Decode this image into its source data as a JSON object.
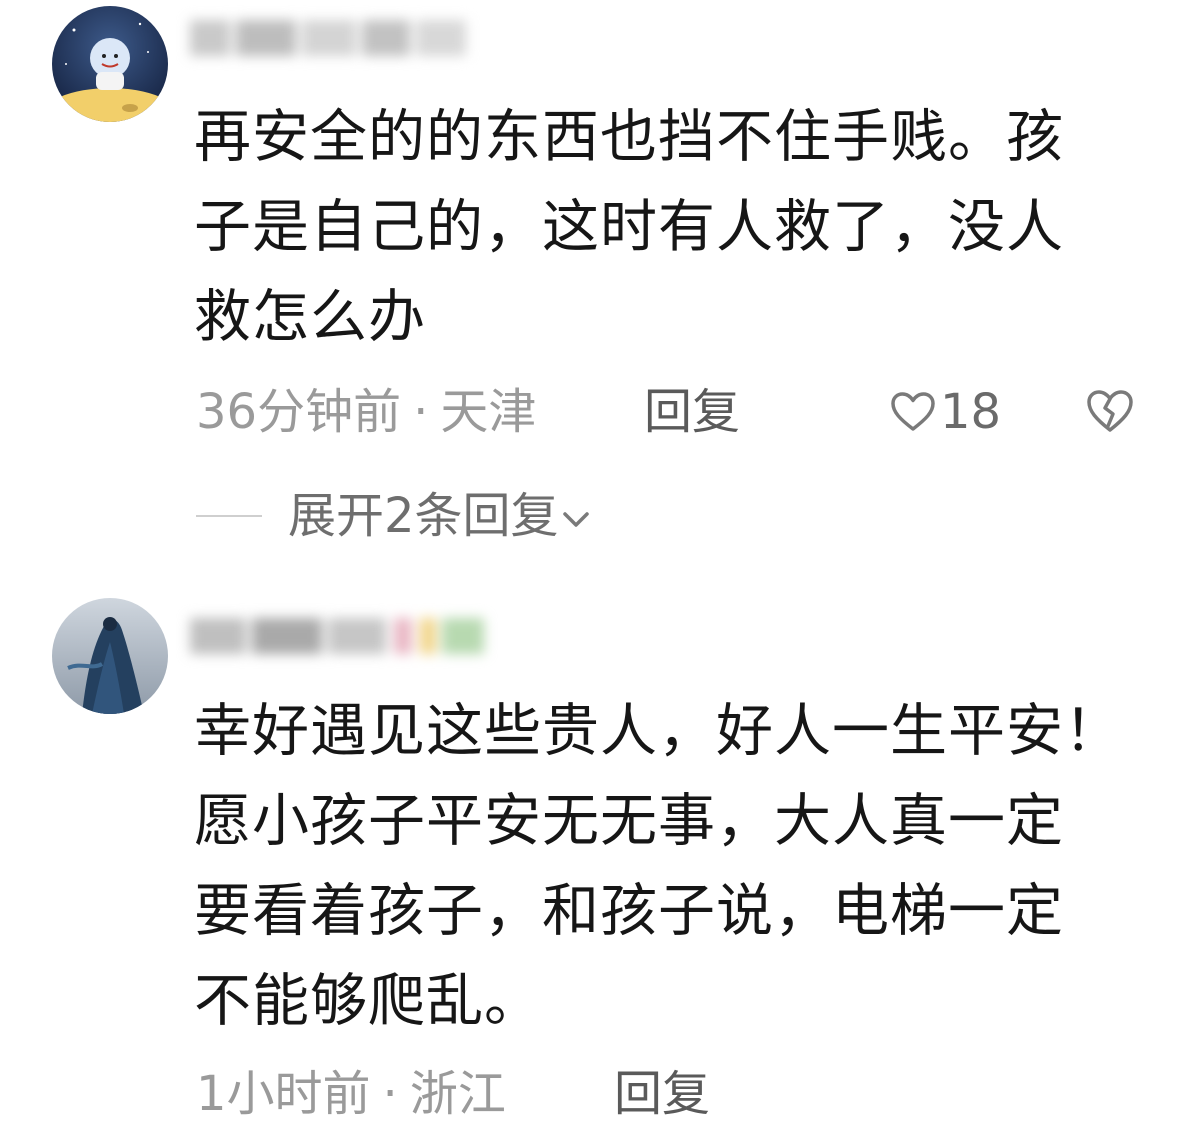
{
  "comments": [
    {
      "text": "再安全的的东西也挡不住手贱。孩\n子是自己的，这时有人救了，没人\n救怎么办",
      "time": "36分钟前",
      "separator": "·",
      "location": "天津",
      "reply_label": "回复",
      "likes": "18",
      "expand_label": "展开2条回复"
    },
    {
      "text": "幸好遇见这些贵人，好人一生平安！\n愿小孩子平安无无事，大人真一定\n要看着孩子，和孩子说，电梯一定\n不能够爬乱。",
      "time": "1小时前",
      "separator": "·",
      "location": "浙江",
      "reply_label": "回复"
    }
  ],
  "icons": {
    "like": "heart-outline-icon",
    "dislike": "broken-heart-outline-icon",
    "expand": "chevron-down-icon"
  },
  "colors": {
    "text": "#161616",
    "meta": "#9a9a9a",
    "reply": "#5a5a5a",
    "background": "#ffffff"
  }
}
